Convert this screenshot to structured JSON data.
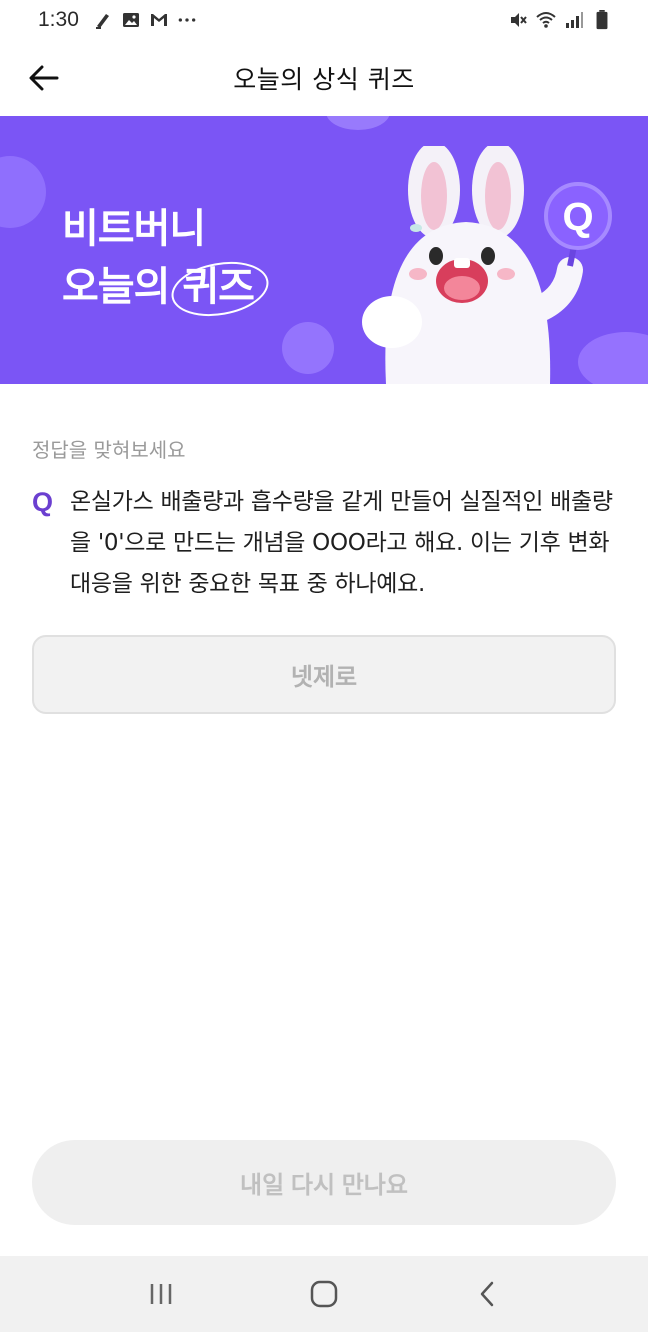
{
  "status_bar": {
    "time": "1:30",
    "left_icons": [
      "pen-icon",
      "image-icon",
      "gmail-icon",
      "more-dots-icon"
    ],
    "right_icons": [
      "mute-icon",
      "wifi-icon",
      "signal-icon",
      "battery-icon"
    ]
  },
  "header": {
    "title": "오늘의 상식 퀴즈",
    "back_icon": "arrow-left-icon"
  },
  "banner": {
    "line1": "비트버니",
    "line2_prefix": "오늘의 ",
    "line2_highlight": "퀴즈",
    "mascot_badge": "Q",
    "background_color": "#7b55f5"
  },
  "question": {
    "prompt": "정답을 맞혀보세요",
    "mark": "Q",
    "text": "온실가스 배출량과 흡수량을 같게 만들어 실질적인 배출량을 '0'으로 만드는 개념을 OOO라고 해요. 이는 기후 변화 대응을 위한 중요한 목표 중 하나예요.",
    "accent_color": "#6b3fd0"
  },
  "answer": {
    "value": "넷제로"
  },
  "cta": {
    "label": "내일 다시 만나요"
  },
  "nav_bar": {
    "icons": [
      "recent-apps-icon",
      "home-icon",
      "back-icon"
    ]
  }
}
